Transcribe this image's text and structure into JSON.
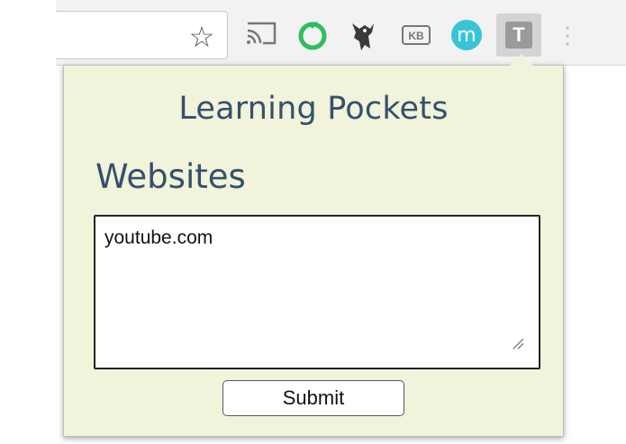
{
  "toolbar": {
    "star_glyph": "☆",
    "icons": [
      "bookmark-star-icon",
      "cast-icon",
      "evernote-icon",
      "ninja-extension-icon",
      "kb-icon",
      "m-extension-icon",
      "learning-pockets-t-icon",
      "more-menu-icon"
    ],
    "kb_label": "KB",
    "m_label": "m",
    "t_label": "T",
    "more_glyph": "⋮"
  },
  "popup": {
    "title": "Learning Pockets",
    "section_label": "Websites",
    "websites_value": "youtube.com",
    "submit_label": "Submit",
    "colors": {
      "background": "#f1f3da",
      "heading": "#34506e",
      "evernote_green": "#2dbe60",
      "m_badge": "#37c5d6"
    }
  }
}
